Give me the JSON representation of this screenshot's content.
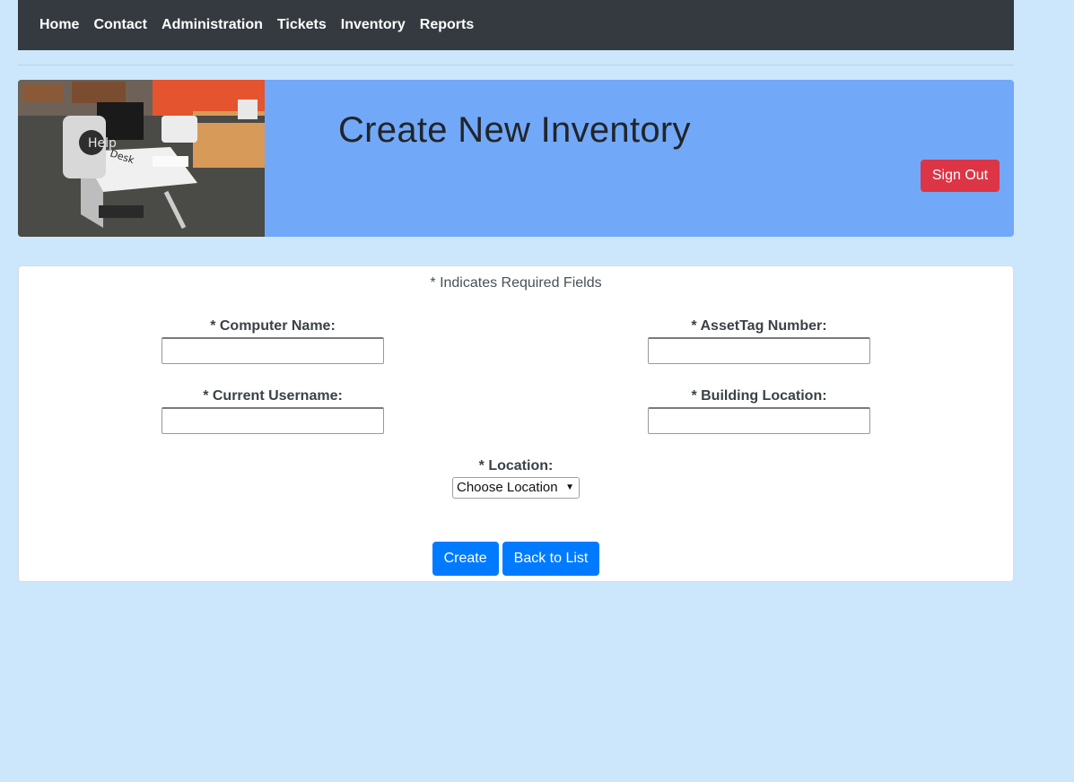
{
  "nav": {
    "items": [
      {
        "label": "Home"
      },
      {
        "label": "Contact"
      },
      {
        "label": "Administration"
      },
      {
        "label": "Tickets"
      },
      {
        "label": "Inventory"
      },
      {
        "label": "Reports"
      }
    ]
  },
  "header": {
    "title": "Create New Inventory",
    "signout_label": "Sign Out",
    "photo_sign": {
      "line1": "Help",
      "line2": "Desk"
    }
  },
  "form": {
    "required_note": "* Indicates Required Fields",
    "computer_name_label": "* Computer Name:",
    "assettag_label": "* AssetTag Number:",
    "username_label": "* Current Username:",
    "building_label": "* Building Location:",
    "location_label": "* Location:",
    "location_selected": "Choose Location",
    "create_label": "Create",
    "back_label": "Back to List"
  },
  "colors": {
    "page_bg": "#cce7fb",
    "navbar": "#343a40",
    "header_bg": "#72a8f8",
    "danger": "#dc3545",
    "primary": "#007bff"
  }
}
